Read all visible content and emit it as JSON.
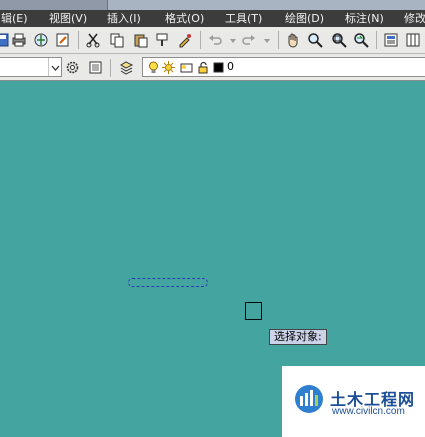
{
  "menu": [
    {
      "label": "辑(E)",
      "name": "menu-edit"
    },
    {
      "label": "视图(V)",
      "name": "menu-view"
    },
    {
      "label": "插入(I)",
      "name": "menu-insert"
    },
    {
      "label": "格式(O)",
      "name": "menu-format"
    },
    {
      "label": "工具(T)",
      "name": "menu-tools"
    },
    {
      "label": "绘图(D)",
      "name": "menu-draw"
    },
    {
      "label": "标注(N)",
      "name": "menu-dimension"
    },
    {
      "label": "修改",
      "name": "menu-modify"
    }
  ],
  "toolbar": {
    "icons": [
      "save-icon",
      "print-icon",
      "publish-icon",
      "plot-preview-icon",
      "cut-icon",
      "copy-icon",
      "paste-icon",
      "match-properties-icon",
      "undo-icon",
      "redo-icon",
      "pan-icon",
      "zoom-realtime-icon",
      "zoom-window-icon",
      "zoom-previous-icon",
      "properties-icon",
      "design-center-icon"
    ]
  },
  "layers": {
    "current_layer": "0",
    "layer_color": "#000000",
    "icons": [
      "layer-manager-icon",
      "layer-on-icon",
      "layer-freeze-icon",
      "layer-viewport-icon",
      "layer-lock-icon",
      "layer-color-swatch"
    ]
  },
  "workspace": {
    "icons": [
      "workspace-settings-icon",
      "workspace-icon"
    ]
  },
  "canvas": {
    "background": "#44a4a0",
    "tooltip": "选择对象:"
  },
  "watermark": {
    "brand": "土木工程网",
    "url": "www.civilcn.com"
  }
}
